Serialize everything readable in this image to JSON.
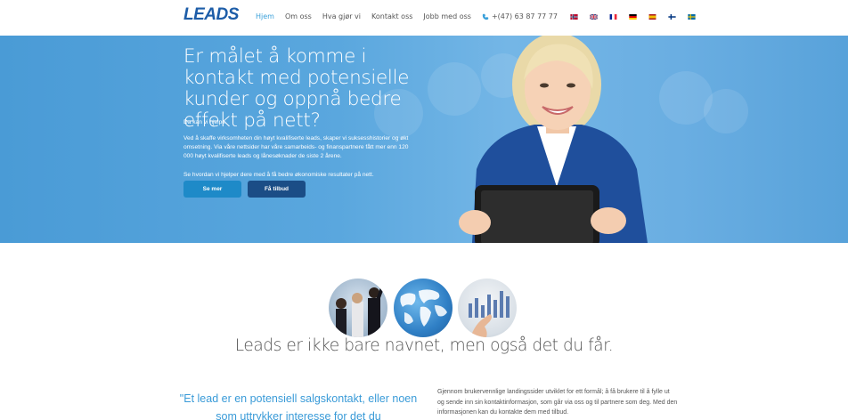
{
  "header": {
    "logo_text": "LEADS",
    "nav": [
      {
        "label": "Hjem",
        "active": true
      },
      {
        "label": "Om oss",
        "active": false
      },
      {
        "label": "Hva gjør vi",
        "active": false
      },
      {
        "label": "Kontakt oss",
        "active": false
      },
      {
        "label": "Jobb med oss",
        "active": false
      }
    ],
    "phone": "+(47) 63 87 77 77",
    "flags": [
      "norway-flag-icon",
      "uk-flag-icon",
      "france-flag-icon",
      "germany-flag-icon",
      "spain-flag-icon",
      "finland-flag-icon",
      "sweden-flag-icon"
    ]
  },
  "hero": {
    "title": "Er målet å komme i kontakt med potensielle kunder og oppnå bedre effekt på nett?",
    "lead": "Da kan vi hjelpe.",
    "body": "Ved å skaffe virksomheten din høyt kvalifiserte leads, skaper vi suksesshistorier og økt omsetning. Via våre nettsider har våre samarbeids- og finanspartnere fått mer enn 120 000 høyt kvalifiserte leads og lånesøknader de siste 2 årene.",
    "cta_text": "Se hvordan vi hjelper dere med å få bedre økonomiske resultater på nett.",
    "btn_more": "Se mer",
    "btn_offer": "Få tilbud"
  },
  "section": {
    "tagline": "Leads er ikke bare navnet, men også det du får.",
    "quote": "\"Et lead er en potensiell salgskontakt, eller noen som uttrykker interesse for det du",
    "right_text": "Gjennom brukervennlige landingssider utviklet for ett formål; å få brukere til å fylle ut og sende inn sin kontaktinformasjon, som går via oss og til partnere som deg. Med den informasjonen kan du kontakte dem med tilbud."
  },
  "colors": {
    "accent": "#3aa0da",
    "logo": "#1d5da8",
    "hero_bg": "#5aa7de",
    "btn_primary": "#1e8ac8",
    "btn_dark": "#1b4d86"
  }
}
